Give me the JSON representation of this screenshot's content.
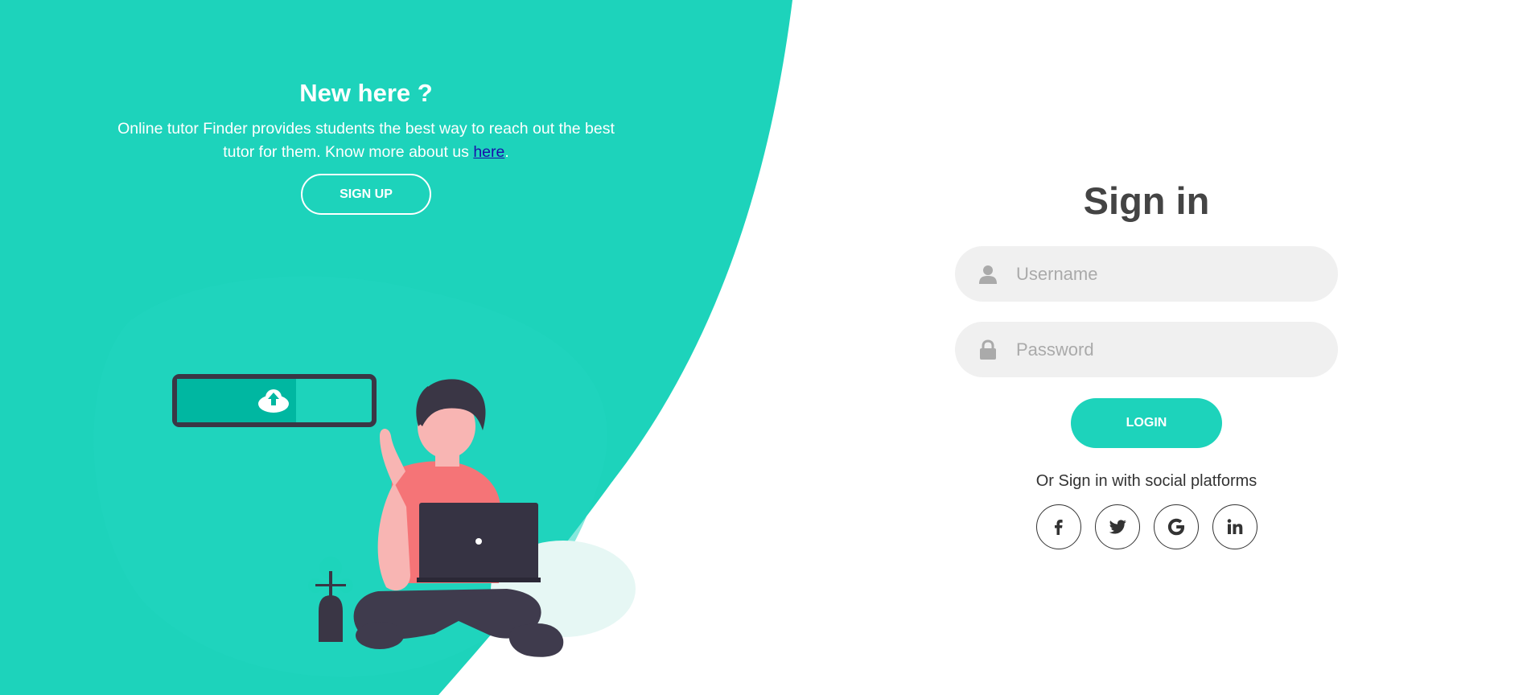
{
  "colors": {
    "accent": "#1dd3bb",
    "form_bg": "#ffffff",
    "input_bg": "#f0f0f0",
    "title_text": "#444444",
    "link": "#1a0dab"
  },
  "left_panel": {
    "title": "New here ?",
    "description": "Online tutor Finder provides students the best way to reach out the best tutor for them. Know more about us ",
    "link_text": "here",
    "trailing_text": ".",
    "signup_label": "SIGN UP"
  },
  "signin": {
    "title": "Sign in",
    "username": {
      "placeholder": "Username",
      "value": "",
      "icon": "user-icon"
    },
    "password": {
      "placeholder": "Password",
      "value": "",
      "icon": "lock-icon"
    },
    "login_label": "LOGIN",
    "social_text": "Or Sign in with social platforms",
    "social_platforms": [
      "facebook-icon",
      "twitter-icon",
      "google-icon",
      "linkedin-icon"
    ]
  }
}
